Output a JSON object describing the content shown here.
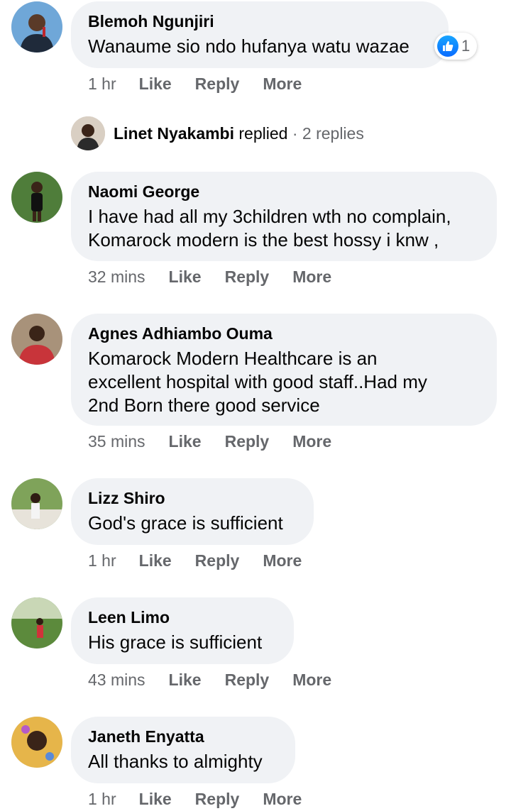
{
  "comments": [
    {
      "name": "Blemoh Ngunjiri",
      "text": "Wanaume sio ndo hufanya watu wazae",
      "time": "1 hr",
      "reaction_count": "1"
    },
    {
      "name": "Naomi George",
      "text_lines": [
        "I have had all my 3children wth no complain,",
        "Komarock modern is the best hossy i knw ,"
      ],
      "time": "32 mins"
    },
    {
      "name": "Agnes Adhiambo Ouma",
      "text_lines": [
        "Komarock Modern Healthcare is an",
        "excellent hospital with good staff..Had my",
        "2nd Born there good service"
      ],
      "time": "35 mins"
    },
    {
      "name": "Lizz Shiro",
      "text": "God's grace is sufficient",
      "time": "1 hr"
    },
    {
      "name": "Leen Limo",
      "text": "His grace is sufficient",
      "time": "43 mins"
    },
    {
      "name": "Janeth Enyatta",
      "text": "All thanks to almighty",
      "time": "1 hr"
    }
  ],
  "reply_preview": {
    "name": "Linet Nyakambi",
    "verb": "replied",
    "separator": "·",
    "count": "2 replies"
  },
  "actions": {
    "like": "Like",
    "reply": "Reply",
    "more": "More"
  },
  "colors": {
    "bubble": "#f0f2f5",
    "meta_text": "#65676b",
    "like_blue": "#0a6cff"
  }
}
